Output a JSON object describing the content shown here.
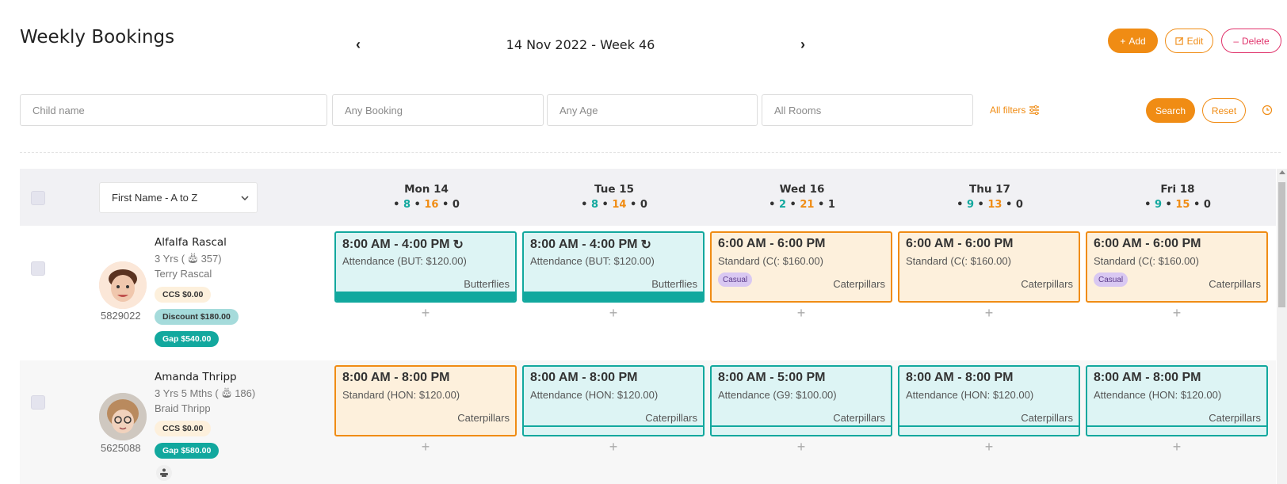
{
  "header": {
    "title": "Weekly Bookings",
    "week_label": "14 Nov 2022 - Week 46",
    "prev_icon": "chevron-left-icon",
    "next_icon": "chevron-right-icon",
    "actions": {
      "add": "Add",
      "edit": "Edit",
      "delete": "Delete"
    }
  },
  "filters": {
    "child_name_placeholder": "Child name",
    "booking_placeholder": "Any Booking",
    "age_placeholder": "Any Age",
    "rooms_placeholder": "All Rooms",
    "all_filters": "All filters",
    "search": "Search",
    "reset": "Reset"
  },
  "grid": {
    "sort_label": "First Name - A to Z",
    "days": [
      {
        "label": "Mon 14",
        "green": "8",
        "orange": "16",
        "gray": "0"
      },
      {
        "label": "Tue 15",
        "green": "8",
        "orange": "14",
        "gray": "0"
      },
      {
        "label": "Wed 16",
        "green": "2",
        "orange": "21",
        "gray": "1"
      },
      {
        "label": "Thu 17",
        "green": "9",
        "orange": "13",
        "gray": "0"
      },
      {
        "label": "Fri 18",
        "green": "9",
        "orange": "15",
        "gray": "0"
      }
    ]
  },
  "children": [
    {
      "name": "Alfalfa Rascal",
      "age": "3 Yrs (",
      "age_count": "357)",
      "parent": "Terry Rascal",
      "id": "5829022",
      "ccs": "CCS $0.00",
      "discount": "Discount $180.00",
      "gap": "Gap $540.00",
      "bookings": [
        {
          "time": "8:00 AM - 4:00 PM",
          "type": "Attendance (BUT: $120.00)",
          "room": "Butterflies",
          "casual": ""
        },
        {
          "time": "8:00 AM - 4:00 PM",
          "type": "Attendance (BUT: $120.00)",
          "room": "Butterflies",
          "casual": ""
        },
        {
          "time": "6:00 AM - 6:00 PM",
          "type": "Standard (C(: $160.00)",
          "room": "Caterpillars",
          "casual": "Casual"
        },
        {
          "time": "6:00 AM - 6:00 PM",
          "type": "Standard (C(: $160.00)",
          "room": "Caterpillars",
          "casual": ""
        },
        {
          "time": "6:00 AM - 6:00 PM",
          "type": "Standard (C(: $160.00)",
          "room": "Caterpillars",
          "casual": "Casual"
        }
      ]
    },
    {
      "name": "Amanda Thripp",
      "age": "3 Yrs 5 Mths (",
      "age_count": "186)",
      "parent": "Braid Thripp",
      "id": "5625088",
      "ccs": "CCS $0.00",
      "gap": "Gap $580.00",
      "bookings": [
        {
          "time": "8:00 AM - 8:00 PM",
          "type": "Standard (HON: $120.00)",
          "room": "Caterpillars"
        },
        {
          "time": "8:00 AM - 8:00 PM",
          "type": "Attendance (HON: $120.00)",
          "room": "Caterpillars"
        },
        {
          "time": "8:00 AM - 5:00 PM",
          "type": "Attendance (G9: $100.00)",
          "room": "Caterpillars"
        },
        {
          "time": "8:00 AM - 8:00 PM",
          "type": "Attendance (HON: $120.00)",
          "room": "Caterpillars"
        },
        {
          "time": "8:00 AM - 8:00 PM",
          "type": "Attendance (HON: $120.00)",
          "room": "Caterpillars"
        }
      ]
    }
  ],
  "add_slot_label": "+",
  "colors": {
    "accent": "#f08c14",
    "teal": "#12a89e",
    "danger": "#e0336b"
  }
}
